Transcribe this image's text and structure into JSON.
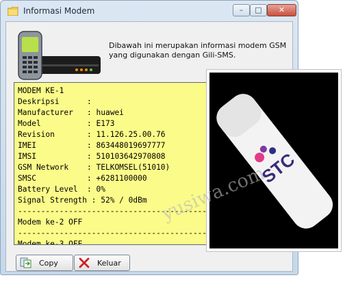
{
  "window": {
    "title": "Informasi Modem"
  },
  "info_text": "Dibawah ini merupakan informasi modem GSM yang digunakan dengan Gili-SMS.",
  "memo_lines": [
    "MODEM KE-1",
    "Deskripsi      :",
    "Manufacturer   : huawei",
    "Model          : E173",
    "Revision       : 11.126.25.00.76",
    "IMEI           : 863448019697777",
    "IMSI           : 510103642970808",
    "GSM Network    : TELKOMSEL(51010)",
    "SMSC           : +6281100000",
    "Battery Level  : 0%",
    "Signal Strength : 52% / 0dBm",
    "---------------------------------------------",
    "Modem ke-2 OFF",
    "---------------------------------------------",
    "Modem ke-3 OFF"
  ],
  "buttons": {
    "copy": "Copy",
    "keluar": "Keluar"
  },
  "controls": {
    "minimize": "–",
    "maximize": "□",
    "close": "✕"
  },
  "watermark": "yusiwa.com",
  "photo_brand": "STC",
  "colors": {
    "memo_bg": "#fbfb8a",
    "title_bg": "#c6d8ea",
    "close_red": "#c7503f"
  },
  "icons": {
    "title": "folder-icon",
    "header": "phone-and-modem-icon",
    "copy": "copy-icon",
    "keluar": "close-x-icon"
  }
}
